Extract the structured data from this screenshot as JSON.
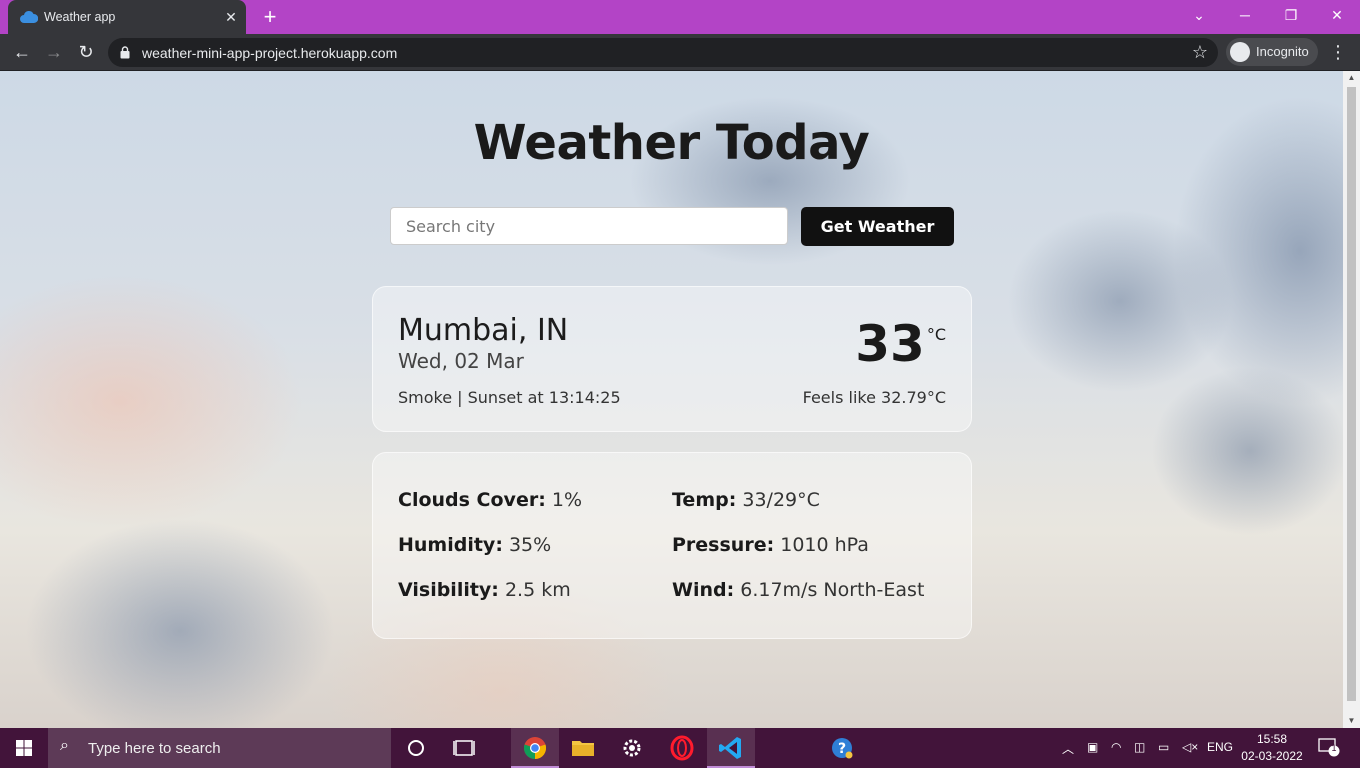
{
  "browser": {
    "tab_title": "Weather app",
    "url": "weather-mini-app-project.herokuapp.com",
    "profile_label": "Incognito"
  },
  "page": {
    "heading": "Weather Today",
    "search_placeholder": "Search city",
    "get_weather_label": "Get Weather"
  },
  "current": {
    "city": "Mumbai, IN",
    "date": "Wed, 02 Mar",
    "description": "Smoke | Sunset at 13:14:25",
    "temp": "33",
    "temp_unit": "°C",
    "feels_like": "Feels like 32.79°C"
  },
  "details": {
    "clouds_label": "Clouds Cover:",
    "clouds_value": " 1%",
    "humidity_label": "Humidity:",
    "humidity_value": " 35%",
    "visibility_label": "Visibility:",
    "visibility_value": " 2.5 km",
    "temp_label": "Temp:",
    "temp_value": " 33/29°C",
    "pressure_label": "Pressure:",
    "pressure_value": " 1010 hPa",
    "wind_label": "Wind:",
    "wind_value": " 6.17m/s North-East"
  },
  "taskbar": {
    "search_placeholder": "Type here to search",
    "language": "ENG",
    "time": "15:58",
    "date": "02-03-2022",
    "notification_count": "1"
  },
  "colors": {
    "titlebar": "#b344c6",
    "taskbar": "#42143a",
    "button": "#111111"
  }
}
